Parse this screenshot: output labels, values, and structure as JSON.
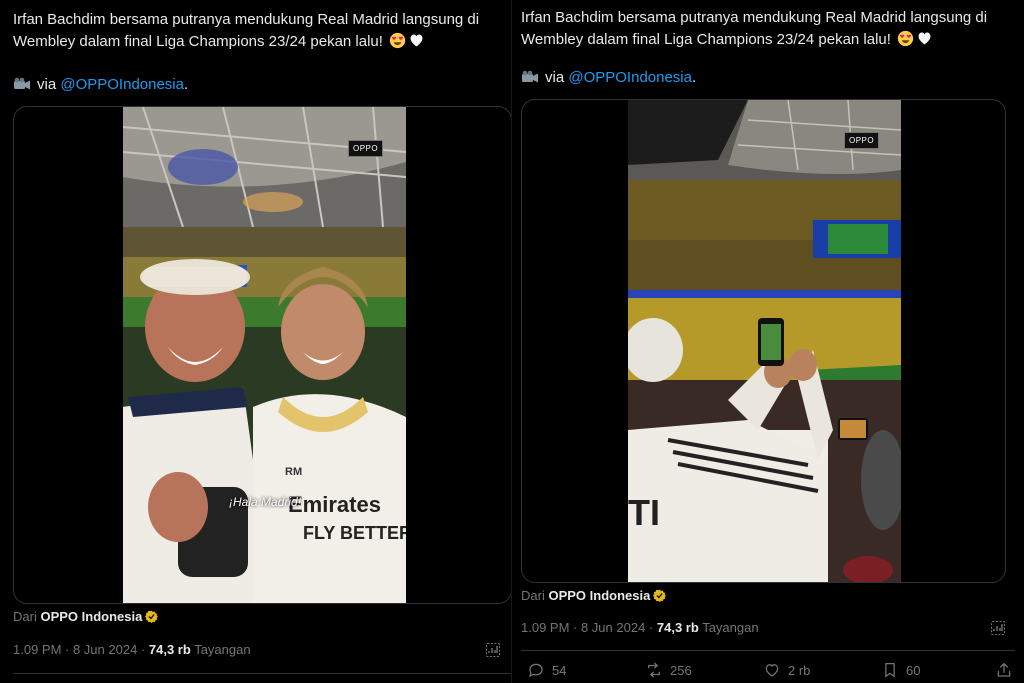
{
  "tweets": [
    {
      "text": "Irfan Bachdim bersama putranya mendukung Real Madrid langsung di Wembley dalam final Liga Champions 23/24 pekan lalu!",
      "via_prefix": "via",
      "mention": "@OPPOIndonesia",
      "via_suffix": ".",
      "badge": "OPPO",
      "caption": "¡Hala Madrid!",
      "source_prefix": "Dari",
      "source_name": "OPPO Indonesia",
      "timestamp": "1.09 PM · 8 Jun 2024 ·",
      "views_count": "74,3 rb",
      "views_label": "Tayangan"
    },
    {
      "text": "Irfan Bachdim bersama putranya mendukung Real Madrid langsung di Wembley dalam final Liga Champions 23/24 pekan lalu!",
      "via_prefix": "via",
      "mention": "@OPPOIndonesia",
      "via_suffix": ".",
      "badge": "OPPO",
      "source_prefix": "Dari",
      "source_name": "OPPO Indonesia",
      "timestamp": "1.09 PM · 8 Jun 2024 ·",
      "views_count": "74,3 rb",
      "views_label": "Tayangan",
      "actions": {
        "replies": "54",
        "reposts": "256",
        "likes": "2 rb",
        "bookmarks": "60"
      }
    }
  ],
  "colors": {
    "background": "#000000",
    "text": "#e7e9ea",
    "muted": "#71767b",
    "link": "#1d9bf0",
    "border": "#2f3336",
    "verified": "#e2b719"
  },
  "icons": [
    "movie-camera-icon",
    "heart-eyes-emoji-icon",
    "white-heart-emoji-icon",
    "verified-badge-icon",
    "analytics-icon",
    "reply-icon",
    "repost-icon",
    "like-icon",
    "bookmark-icon",
    "share-icon"
  ]
}
